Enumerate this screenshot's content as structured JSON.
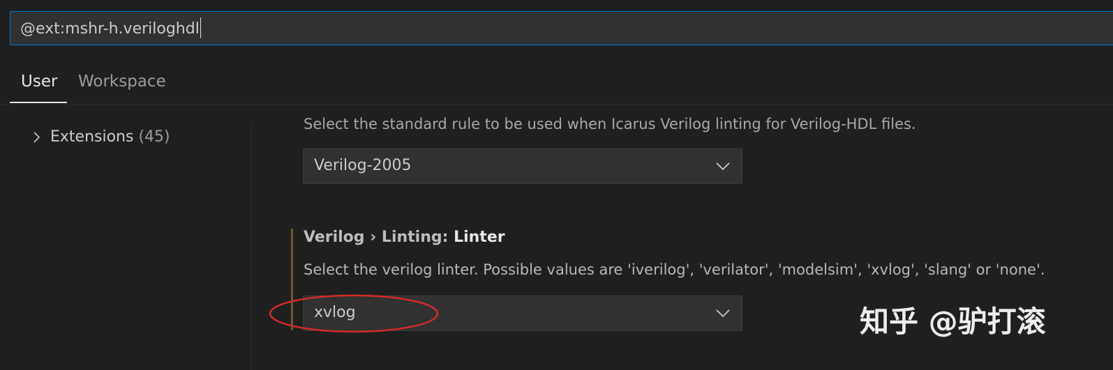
{
  "search": {
    "value": "@ext:mshr-h.veriloghdl"
  },
  "tabs": [
    {
      "label": "User",
      "active": true
    },
    {
      "label": "Workspace",
      "active": false
    }
  ],
  "tree": {
    "items": [
      {
        "label": "Extensions",
        "count": "(45)"
      }
    ]
  },
  "settings": {
    "standard": {
      "description": "Select the standard rule to be used when Icarus Verilog linting for Verilog-HDL files.",
      "value": "Verilog-2005"
    },
    "linter": {
      "title_category": "Verilog › Linting: ",
      "title_name": "Linter",
      "description": "Select the verilog linter. Possible values are 'iverilog', 'verilator', 'modelsim', 'xvlog', 'slang' or 'none'.",
      "value": "xvlog"
    }
  },
  "watermark": {
    "text": "知乎 @驴打滚"
  },
  "colors": {
    "focus_border": "#0078d4",
    "annotation": "#d42a2a",
    "modified_indicator": "#6e5a2a"
  }
}
